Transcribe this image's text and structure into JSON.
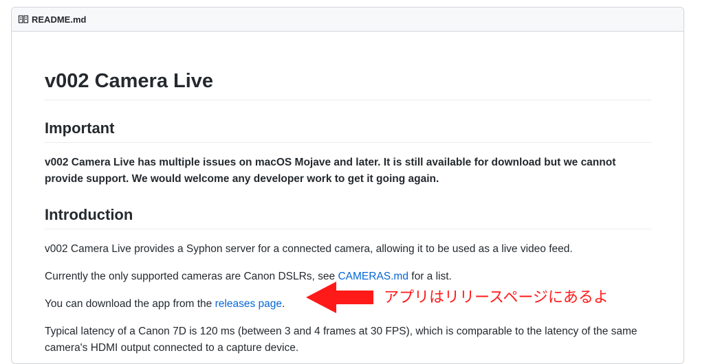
{
  "readme": {
    "filename": "README.md",
    "title": "v002 Camera Live",
    "important": {
      "heading": "Important",
      "text": "v002 Camera Live has multiple issues on macOS Mojave and later. It is still available for download but we cannot provide support. We would welcome any developer work to get it going again."
    },
    "introduction": {
      "heading": "Introduction",
      "p1": "v002 Camera Live provides a Syphon server for a connected camera, allowing it to be used as a live video feed.",
      "p2_before": "Currently the only supported cameras are Canon DSLRs, see ",
      "p2_link": "CAMERAS.md",
      "p2_after": " for a list.",
      "p3_before": "You can download the app from the ",
      "p3_link": "releases page",
      "p3_after": ".",
      "p4": "Typical latency of a Canon 7D is 120 ms (between 3 and 4 frames at 30 FPS), which is comparable to the latency of the same camera's HDMI output connected to a capture device."
    }
  },
  "annotation": {
    "text": "アプリはリリースページにあるよ",
    "color": "#ff1a1a"
  },
  "colors": {
    "link": "#0366d6",
    "border": "#d1d5da",
    "header_bg": "#f6f8fa"
  }
}
